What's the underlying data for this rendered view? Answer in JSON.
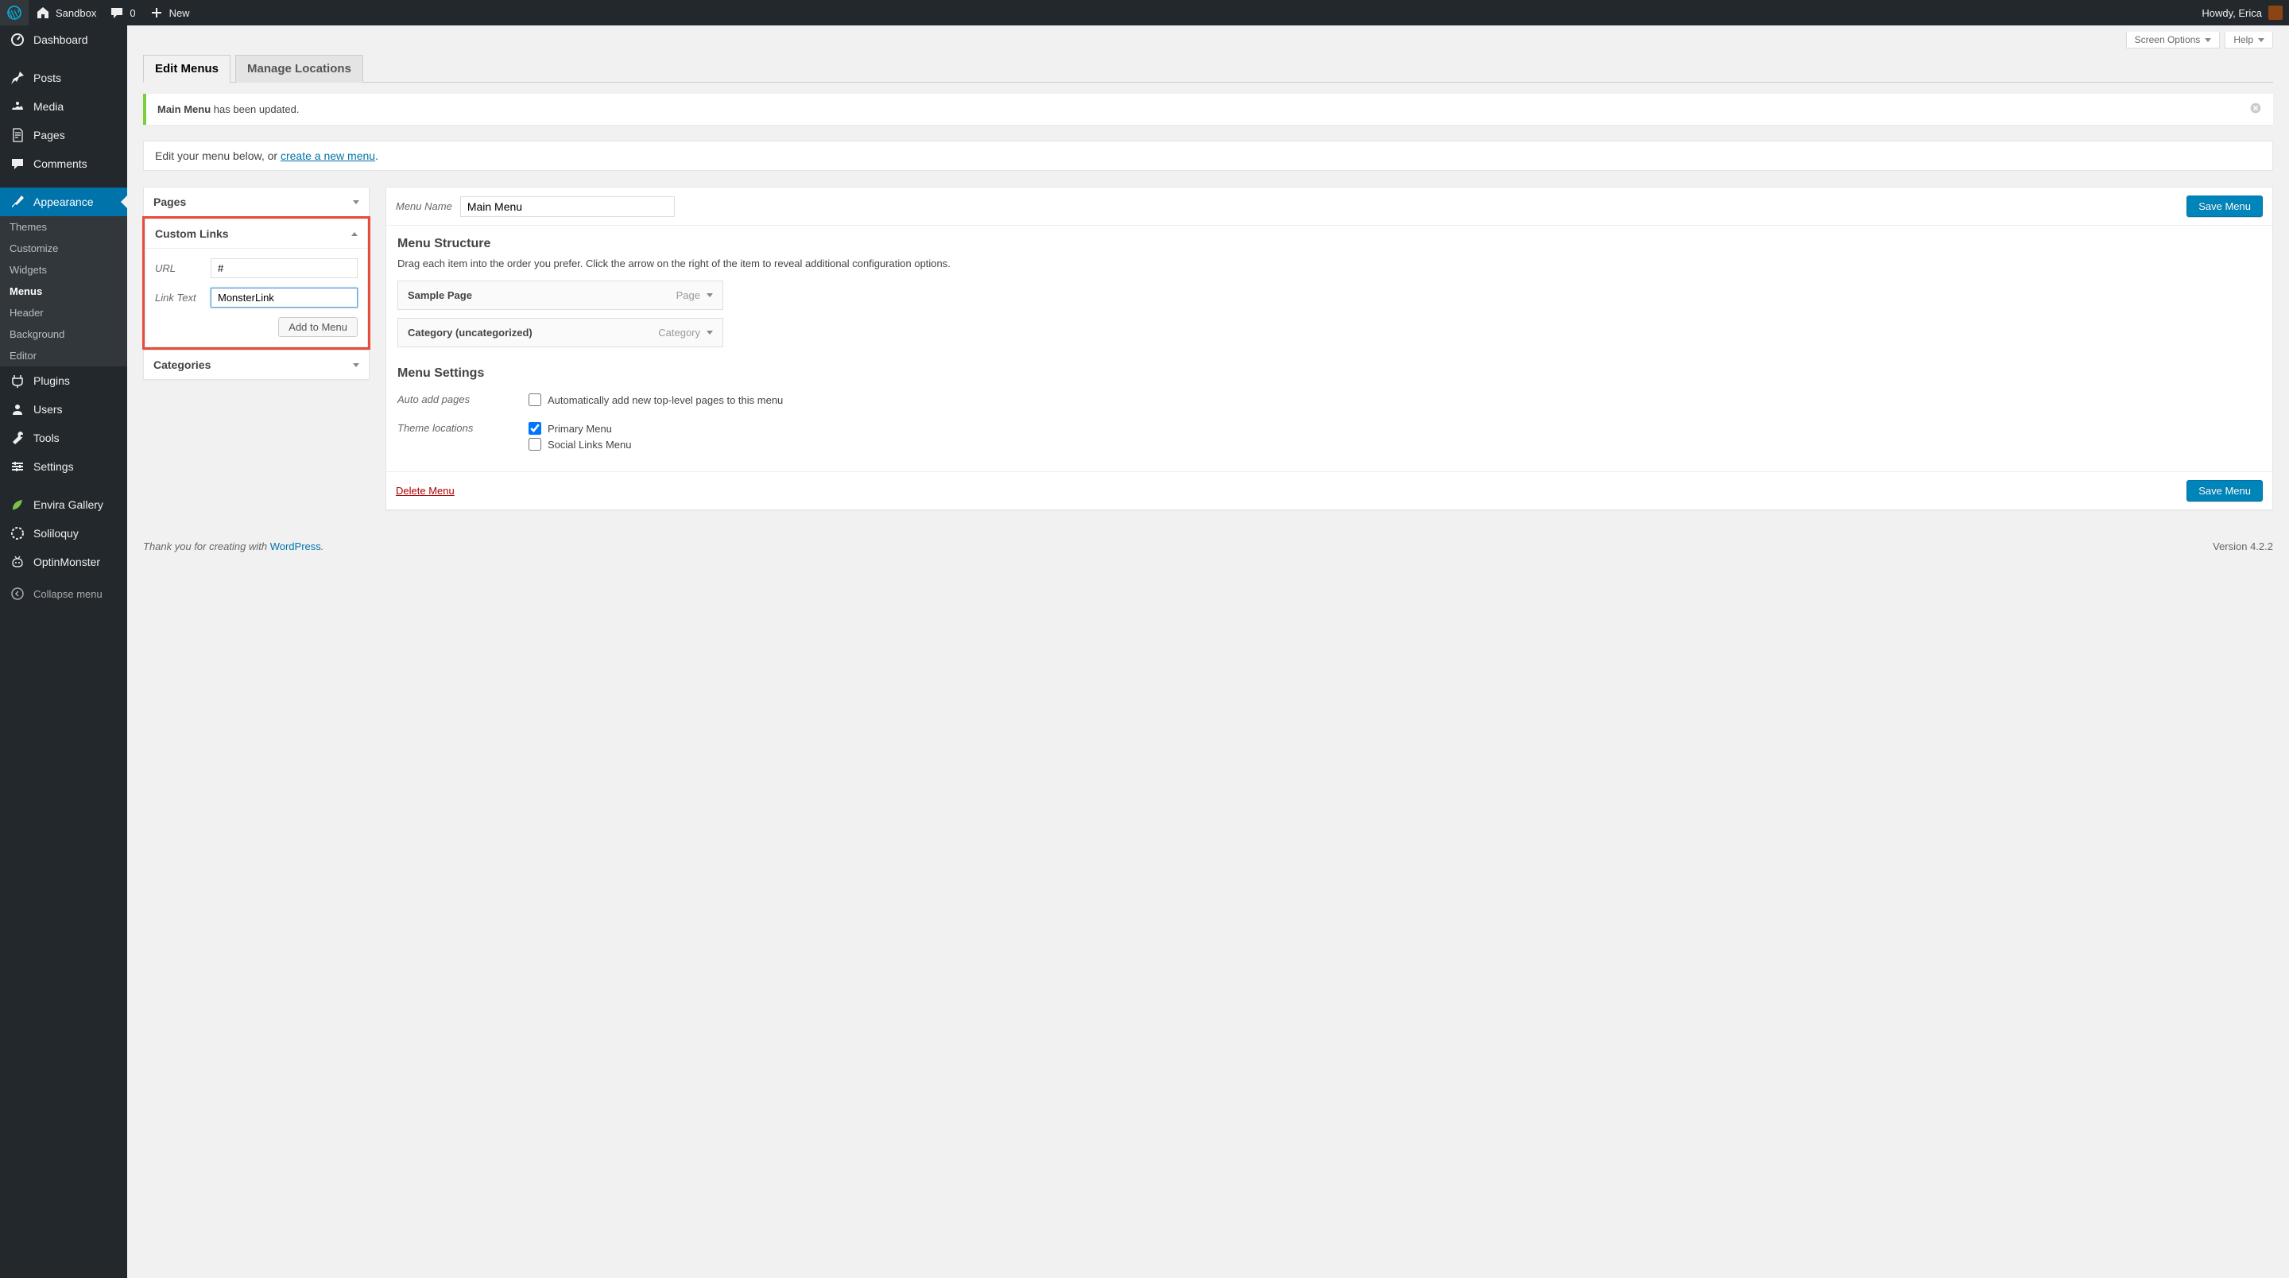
{
  "admin_bar": {
    "site_name": "Sandbox",
    "comments_count": "0",
    "new_label": "New",
    "howdy": "Howdy, Erica"
  },
  "sidebar": {
    "items": [
      {
        "label": "Dashboard"
      },
      {
        "label": "Posts"
      },
      {
        "label": "Media"
      },
      {
        "label": "Pages"
      },
      {
        "label": "Comments"
      },
      {
        "label": "Appearance"
      },
      {
        "label": "Plugins"
      },
      {
        "label": "Users"
      },
      {
        "label": "Tools"
      },
      {
        "label": "Settings"
      },
      {
        "label": "Envira Gallery"
      },
      {
        "label": "Soliloquy"
      },
      {
        "label": "OptinMonster"
      }
    ],
    "appearance_sub": [
      {
        "label": "Themes"
      },
      {
        "label": "Customize"
      },
      {
        "label": "Widgets"
      },
      {
        "label": "Menus"
      },
      {
        "label": "Header"
      },
      {
        "label": "Background"
      },
      {
        "label": "Editor"
      }
    ],
    "collapse_label": "Collapse menu"
  },
  "meta": {
    "screen_options": "Screen Options",
    "help": "Help"
  },
  "tabs": {
    "edit": "Edit Menus",
    "manage": "Manage Locations"
  },
  "notice": {
    "strong": "Main Menu",
    "rest": " has been updated."
  },
  "intro": {
    "text_before": "Edit your menu below, or ",
    "link": "create a new menu",
    "text_after": "."
  },
  "left_panel": {
    "pages_title": "Pages",
    "custom_links_title": "Custom Links",
    "url_label": "URL",
    "url_value": "#",
    "link_text_label": "Link Text",
    "link_text_value": "MonsterLink",
    "add_button": "Add to Menu",
    "categories_title": "Categories"
  },
  "menu_edit": {
    "name_label": "Menu Name",
    "name_value": "Main Menu",
    "save_label": "Save Menu",
    "structure_title": "Menu Structure",
    "structure_desc": "Drag each item into the order you prefer. Click the arrow on the right of the item to reveal additional configuration options.",
    "items": [
      {
        "title": "Sample Page",
        "type": "Page"
      },
      {
        "title": "Category (uncategorized)",
        "type": "Category"
      }
    ],
    "settings_title": "Menu Settings",
    "auto_add_label": "Auto add pages",
    "auto_add_text": "Automatically add new top-level pages to this menu",
    "locations_label": "Theme locations",
    "locations": [
      {
        "label": "Primary Menu",
        "checked": true
      },
      {
        "label": "Social Links Menu",
        "checked": false
      }
    ],
    "delete_label": "Delete Menu"
  },
  "footer": {
    "thanks_before": "Thank you for creating with ",
    "thanks_link": "WordPress",
    "thanks_after": ".",
    "version": "Version 4.2.2"
  }
}
